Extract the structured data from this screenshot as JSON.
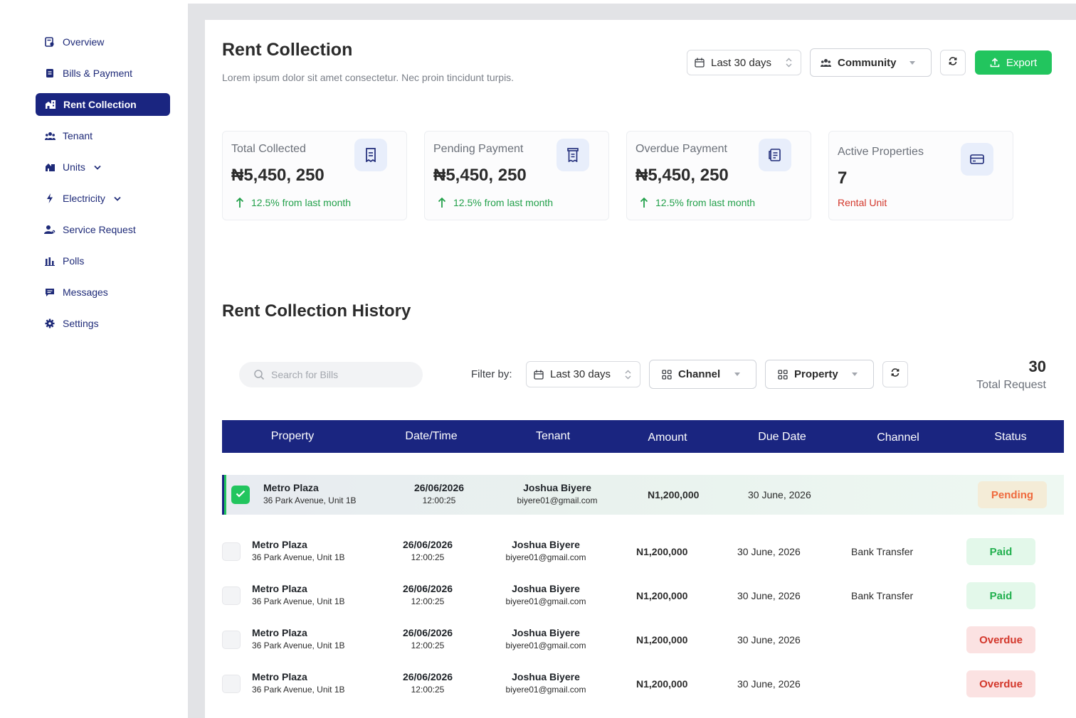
{
  "sidebar": {
    "items": [
      {
        "label": "Overview",
        "icon": "overview-icon"
      },
      {
        "label": "Bills & Payment",
        "icon": "bills-icon"
      },
      {
        "label": "Rent Collection",
        "icon": "rent-icon",
        "active": true
      },
      {
        "label": "Tenant",
        "icon": "tenant-icon"
      },
      {
        "label": "Units",
        "icon": "units-icon",
        "has_children": true
      },
      {
        "label": "Electricity",
        "icon": "electricity-icon",
        "has_children": true
      },
      {
        "label": "Service Request",
        "icon": "service-icon"
      },
      {
        "label": "Polls",
        "icon": "polls-icon"
      },
      {
        "label": "Messages",
        "icon": "messages-icon"
      },
      {
        "label": "Settings",
        "icon": "settings-icon"
      }
    ]
  },
  "header": {
    "title": "Rent Collection",
    "subtitle": "Lorem ipsum dolor sit amet consectetur. Nec proin tincidunt turpis.",
    "date_range": "Last 30 days",
    "community": "Community",
    "export_label": "Export"
  },
  "stats": [
    {
      "title": "Total Collected",
      "value": "₦5,450, 250",
      "foot": "12.5% from last month"
    },
    {
      "title": "Pending Payment",
      "value": "₦5,450, 250",
      "foot": "12.5% from last month"
    },
    {
      "title": "Overdue Payment",
      "value": "₦5,450, 250",
      "foot": "12.5% from last month"
    },
    {
      "title": "Active Properties",
      "value": "7",
      "foot": "Rental Unit"
    }
  ],
  "history": {
    "title": "Rent Collection History",
    "search_placeholder": "Search for Bills",
    "filter_label": "Filter by:",
    "filter_date": "Last 30 days",
    "filter_channel": "Channel",
    "filter_property": "Property",
    "total_count": "30",
    "total_label": "Total Request",
    "columns": [
      "Property",
      "Date/Time",
      "Tenant",
      "Amount",
      "Due Date",
      "Channel",
      "Status"
    ],
    "rows": [
      {
        "property": "Metro Plaza",
        "address": "36 Park Avenue, Unit 1B",
        "date": "26/06/2026",
        "time": "12:00:25",
        "tenant": "Joshua Biyere",
        "email": "biyere01@gmail.com",
        "amount": "N1,200,000",
        "due": "30 June, 2026",
        "channel": "",
        "status": "Pending",
        "checked": true
      },
      {
        "property": "Metro Plaza",
        "address": "36 Park Avenue, Unit 1B",
        "date": "26/06/2026",
        "time": "12:00:25",
        "tenant": "Joshua Biyere",
        "email": "biyere01@gmail.com",
        "amount": "N1,200,000",
        "due": "30 June, 2026",
        "channel": "Bank Transfer",
        "status": "Paid",
        "checked": false
      },
      {
        "property": "Metro Plaza",
        "address": "36 Park Avenue, Unit 1B",
        "date": "26/06/2026",
        "time": "12:00:25",
        "tenant": "Joshua Biyere",
        "email": "biyere01@gmail.com",
        "amount": "N1,200,000",
        "due": "30 June, 2026",
        "channel": "Bank Transfer",
        "status": "Paid",
        "checked": false
      },
      {
        "property": "Metro Plaza",
        "address": "36 Park Avenue, Unit 1B",
        "date": "26/06/2026",
        "time": "12:00:25",
        "tenant": "Joshua Biyere",
        "email": "biyere01@gmail.com",
        "amount": "N1,200,000",
        "due": "30 June, 2026",
        "channel": "",
        "status": "Overdue",
        "checked": false
      },
      {
        "property": "Metro Plaza",
        "address": "36 Park Avenue, Unit 1B",
        "date": "26/06/2026",
        "time": "12:00:25",
        "tenant": "Joshua Biyere",
        "email": "biyere01@gmail.com",
        "amount": "N1,200,000",
        "due": "30 June, 2026",
        "channel": "",
        "status": "Overdue",
        "checked": false
      }
    ]
  },
  "colors": {
    "primary": "#1a2580",
    "accent_green": "#22c55e",
    "danger": "#d3372b",
    "warning": "#ef6a3d"
  }
}
